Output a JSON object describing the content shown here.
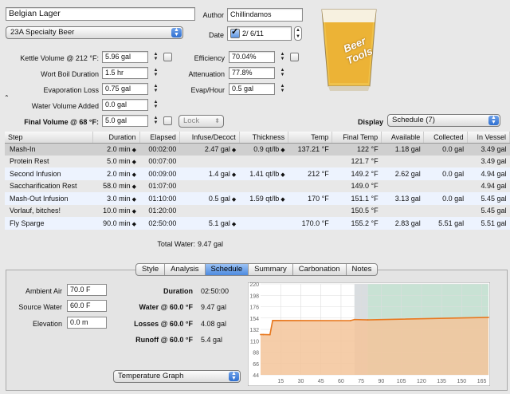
{
  "recipe": {
    "name": "Belgian Lager",
    "style": "23A Specialty Beer",
    "author_label": "Author",
    "author": "Chillindamos",
    "date_label": "Date",
    "date": "2/  6/11",
    "logo_text": "Beer Tools"
  },
  "params": {
    "kettle_volume_label": "Kettle Volume @ 212 °F:",
    "kettle_volume": "5.96 gal",
    "wort_boil_label": "Wort Boil Duration",
    "wort_boil": "1.5 hr",
    "evap_loss_label": "Evaporation Loss",
    "evap_loss": "0.75 gal",
    "water_added_label": "Water Volume Added",
    "water_added": "0.0 gal",
    "final_volume_label": "Final Volume @ 68 °F:",
    "final_volume": "5.0 gal",
    "efficiency_label": "Efficiency",
    "efficiency": "70.04%",
    "attenuation_label": "Attenuation",
    "attenuation": "77.8%",
    "evap_hour_label": "Evap/Hour",
    "evap_hour": "0.5 gal",
    "lock_label": "Lock",
    "display_label": "Display",
    "display_value": "Schedule (7)"
  },
  "table": {
    "headers": [
      "Step",
      "Duration",
      "Elapsed",
      "Infuse/Decoct",
      "Thickness",
      "Temp",
      "Final Temp",
      "Available",
      "Collected",
      "In Vessel"
    ],
    "rows": [
      [
        "Mash-In",
        "2.0 min",
        "00:02:00",
        "2.47 gal",
        "0.9 qt/lb",
        "137.21 °F",
        "122 °F",
        "1.18 gal",
        "0.0 gal",
        "3.49 gal"
      ],
      [
        "Protein Rest",
        "5.0 min",
        "00:07:00",
        "",
        "",
        "",
        "121.7 °F",
        "",
        "",
        "3.49 gal"
      ],
      [
        "Second Infusion",
        "2.0 min",
        "00:09:00",
        "1.4 gal",
        "1.41 qt/lb",
        "212 °F",
        "149.2 °F",
        "2.62 gal",
        "0.0 gal",
        "4.94 gal"
      ],
      [
        "Saccharification Rest",
        "58.0 min",
        "01:07:00",
        "",
        "",
        "",
        "149.0 °F",
        "",
        "",
        "4.94 gal"
      ],
      [
        "Mash-Out Infusion",
        "3.0 min",
        "01:10:00",
        "0.5 gal",
        "1.59 qt/lb",
        "170 °F",
        "151.1 °F",
        "3.13 gal",
        "0.0 gal",
        "5.45 gal"
      ],
      [
        "Vorlauf, bitches!",
        "10.0 min",
        "01:20:00",
        "",
        "",
        "",
        "150.5 °F",
        "",
        "",
        "5.45 gal"
      ],
      [
        "Fly Sparge",
        "90.0 min",
        "02:50:00",
        "5.1 gal",
        "",
        "170.0 °F",
        "155.2 °F",
        "2.83 gal",
        "5.51 gal",
        "5.51 gal"
      ]
    ],
    "total_water_label": "Total Water:",
    "total_water": "9.47 gal"
  },
  "tabs": [
    "Style",
    "Analysis",
    "Schedule",
    "Summary",
    "Carbonation",
    "Notes"
  ],
  "active_tab": "Schedule",
  "schedule": {
    "ambient_label": "Ambient Air",
    "ambient": "70.0 F",
    "source_label": "Source Water",
    "source": "60.0 F",
    "elevation_label": "Elevation",
    "elevation": "0.0 m",
    "duration_label": "Duration",
    "duration": "02:50:00",
    "water_label": "Water @ 60.0 °F",
    "water": "9.47 gal",
    "losses_label": "Losses @ 60.0 °F",
    "losses": "4.08 gal",
    "runoff_label": "Runoff @ 60.0 °F",
    "runoff": "5.4 gal",
    "graph_select": "Temperature Graph"
  },
  "chart_data": {
    "type": "area",
    "x": [
      0,
      2,
      7,
      9,
      67,
      70,
      80,
      170
    ],
    "y": [
      122,
      122,
      121.7,
      149.2,
      149.0,
      151.1,
      150.5,
      155.2
    ],
    "xticks": [
      "15",
      "30",
      "45",
      "60",
      "75",
      "90",
      "105",
      "120",
      "135",
      "150",
      "165"
    ],
    "yticks": [
      "44",
      "66",
      "88",
      "110",
      "132",
      "154",
      "176",
      "198",
      "220"
    ],
    "ylim": [
      44,
      220
    ],
    "xlim": [
      0,
      170
    ],
    "colors": {
      "line": "#e8781e",
      "fill": "#f3c49a",
      "band_gray": "#d9dde0",
      "band_green": "#c8e2d4"
    }
  }
}
